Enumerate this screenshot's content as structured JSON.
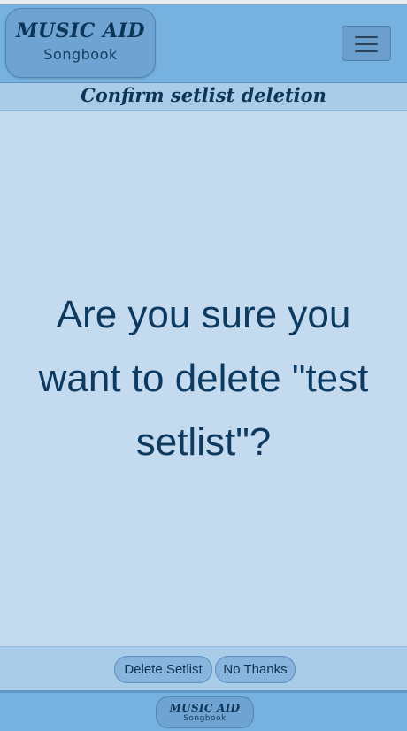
{
  "navbar": {
    "brand_title": "MUSIC AID",
    "brand_subtitle": "Songbook",
    "menu_icon": "hamburger-icon"
  },
  "header": {
    "title": "Confirm setlist deletion"
  },
  "main": {
    "question": "Are you sure you want to delete \"test setlist\"?"
  },
  "actions": {
    "delete_label": "Delete Setlist",
    "cancel_label": "No Thanks"
  },
  "footer": {
    "brand_title": "MUSIC AID",
    "brand_subtitle": "Songbook"
  },
  "colors": {
    "navbar": "#77b1df",
    "page_background": "#c4daee",
    "header_background": "#a9cce9",
    "text": "#0d3a60"
  }
}
